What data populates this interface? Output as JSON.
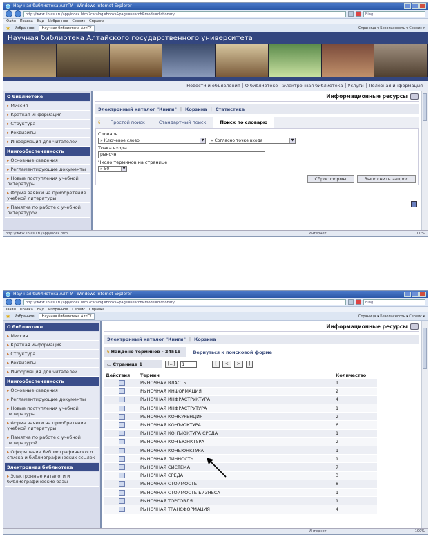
{
  "browser": {
    "window_title": "Научная библиотека АлтГУ - Windows Internet Explorer",
    "address": "http://www.lib.asu.ru/app/index.html?catalog=books&page=search&mode=dictionary",
    "search_placeholder": "Bing",
    "menu": [
      "Файл",
      "Правка",
      "Вид",
      "Избранное",
      "Сервис",
      "Справка"
    ],
    "favorites_label": "Избранное",
    "tab_label": "Научная библиотека АлтГУ",
    "tab_tools": "Страница ▾  Безопасность ▾  Сервис ▾",
    "status_url": "http://www.lib.asu.ru/app/index.html",
    "status_zone": "Интернет",
    "zoom": "100%"
  },
  "banner": {
    "title": "Научная библиотека Алтайского государственного университета",
    "nav": [
      "Новости и объявления",
      "О библиотеке",
      "Электронная библиотека",
      "Услуги",
      "Полезная информация"
    ]
  },
  "sidebar": {
    "about_header": "О библиотеке",
    "about_items": [
      "Миссия",
      "Краткая информация",
      "Структура",
      "Реквизиты",
      "Информация для читателей"
    ],
    "supply_header": "Книгообеспеченность",
    "supply_items": [
      "Основные сведения",
      "Регламентирующие документы",
      "Новые поступления учебной литературы",
      "Форма заявки на приобретение учебной литературы",
      "Памятка по работе с учебной литературой",
      "Оформление библиографического списка и библиографических ссылок"
    ],
    "elib_header": "Электронная библиотека",
    "elib_items": [
      "Электронные каталоги и библиографические базы"
    ]
  },
  "main": {
    "section_title": "Информационные ресурсы",
    "catalog_link": "Электронный каталог \"Книги\"",
    "cart_link": "Корзина",
    "stats_link": "Статистика",
    "tabs": [
      "Простой поиск",
      "Стандартный поиск",
      "Поиск по словарю"
    ],
    "dictionary_label": "Словарь",
    "dictionary_value": "» Ключевое слово",
    "match_value": "» Согласно точке входа",
    "entry_label": "Точка входа",
    "entry_value": "рыночн",
    "per_page_label": "Число терминов на странице",
    "per_page_value": "» 50",
    "reset_button": "Сброс формы",
    "submit_button": "Выполнить запрос"
  },
  "results": {
    "found": "Найдено терминов - 24519",
    "back_link": "Вернуться к поисковой форме",
    "page_label": "Страница 1",
    "page_input": "1",
    "pager_first": "[...]",
    "pager_buttons": [
      "[",
      "<",
      ">",
      "]"
    ],
    "columns": [
      "Действия",
      "Термин",
      "Количество"
    ],
    "rows": [
      {
        "term": "РЫНОЧНАЯ ВЛАСТЬ",
        "count": "1"
      },
      {
        "term": "РЫНОЧНАЯ ИНФОРМАЦИЯ",
        "count": "2"
      },
      {
        "term": "РЫНОЧНАЯ ИНФРАСТРУКТУРА",
        "count": "4"
      },
      {
        "term": "РЫНОЧНАЯ ИНФРАСТРУТУРА",
        "count": "1"
      },
      {
        "term": "РЫНОЧНАЯ КОНКУРЕНЦИЯ",
        "count": "2"
      },
      {
        "term": "РЫНОЧНАЯ КОНЪЮКТУРА",
        "count": "6"
      },
      {
        "term": "РЫНОЧНАЯ КОНЪЮКТУРА СРЕДА",
        "count": "1"
      },
      {
        "term": "РЫНОЧНАЯ КОНЪЮНКТУРА",
        "count": "2"
      },
      {
        "term": "РЫНОЧНАЯ КОНЬЮНКТУРА",
        "count": "1"
      },
      {
        "term": "РЫНОЧНАЯ ЛИЧНОСТЬ",
        "count": "1"
      },
      {
        "term": "РЫНОЧНАЯ СИСТЕМА",
        "count": "7"
      },
      {
        "term": "РЫНОЧНАЯ СРЕДА",
        "count": "3"
      },
      {
        "term": "РЫНОЧНАЯ СТОИМОСТЬ",
        "count": "8"
      },
      {
        "term": "РЫНОЧНАЯ СТОИМОСТЬ БИЗНЕСА",
        "count": "1"
      },
      {
        "term": "РЫНОЧНАЯ ТОРГОВЛЯ",
        "count": "1"
      },
      {
        "term": "РЫНОЧНАЯ ТРАНСФОРМАЦИЯ",
        "count": "4"
      }
    ]
  },
  "colors": {
    "title_bar": "#2b58a8",
    "sidebar_header": "#3a4d8a",
    "banner": "#33467f",
    "link": "#3b4d7c"
  }
}
